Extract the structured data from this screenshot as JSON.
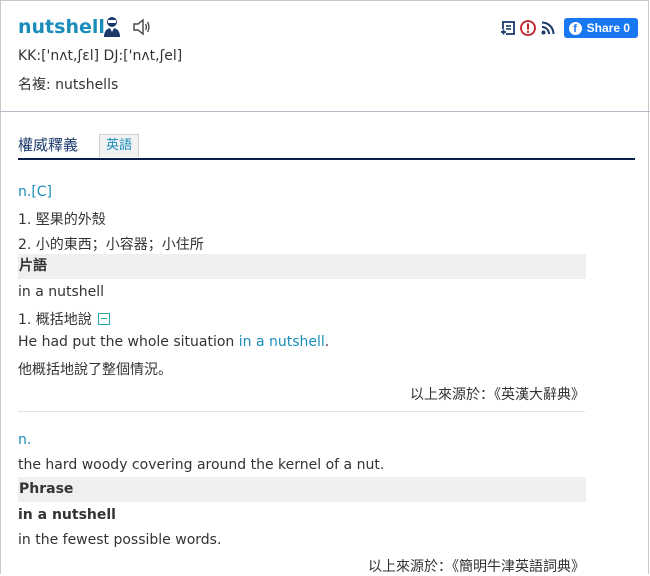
{
  "header": {
    "word": "nutshell",
    "pronunciation": "KK:['nʌt,ʃɛl] DJ:['nʌt,ʃel]",
    "plural": "名複: nutshells",
    "icons": [
      "person-speaker-icon",
      "sound-icon",
      "bookmark-add-icon",
      "report-icon",
      "rss-icon"
    ],
    "share_label": "Share 0"
  },
  "tabs": {
    "title": "權威釋義",
    "english_tab": "英語"
  },
  "entry1": {
    "pos": "n.[C]",
    "def1": "1. 堅果的外殼",
    "def2": "2. 小的東西；小容器；小住所",
    "phrase_header": "片語",
    "phrase": "in a nutshell",
    "phrase_def": "1. 概括地說",
    "example_before": "He had put the whole situation ",
    "example_highlight": "in a nutshell",
    "example_after": ".",
    "example_translation": "他概括地說了整個情況。",
    "source": "以上來源於：《英漢大辭典》"
  },
  "entry2": {
    "pos": "n.",
    "def": "the hard woody covering around the kernel of a nut.",
    "phrase_header": "Phrase",
    "phrase": "in a nutshell",
    "phrase_def": "in the fewest possible words.",
    "source": "以上來源於：《簡明牛津英語詞典》"
  },
  "colors": {
    "accent": "#1a8dba",
    "facebook": "#1877f2",
    "tab_underline": "#0b1f4b"
  }
}
